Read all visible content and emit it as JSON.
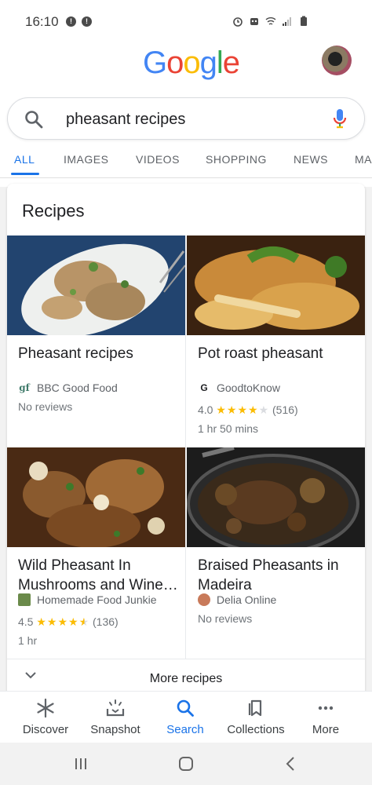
{
  "status": {
    "time": "16:10",
    "notifications": [
      "!",
      "!"
    ]
  },
  "header": {
    "logo_letters": [
      {
        "ch": "G",
        "color": "#4285f4"
      },
      {
        "ch": "o",
        "color": "#ea4335"
      },
      {
        "ch": "o",
        "color": "#fbbc05"
      },
      {
        "ch": "g",
        "color": "#4285f4"
      },
      {
        "ch": "l",
        "color": "#34a853"
      },
      {
        "ch": "e",
        "color": "#ea4335"
      }
    ]
  },
  "search": {
    "query": "pheasant recipes"
  },
  "tabs": [
    "ALL",
    "IMAGES",
    "VIDEOS",
    "SHOPPING",
    "NEWS",
    "MA"
  ],
  "recipes": {
    "title": "Recipes",
    "items": [
      {
        "name": "Pheasant recipes",
        "source": "BBC Good Food",
        "source_logo": "gf",
        "reviews": "No reviews",
        "rating": null,
        "count": null,
        "time": null
      },
      {
        "name": "Pot roast pheasant",
        "source": "GoodtoKnow",
        "source_logo": "G",
        "reviews": null,
        "rating": "4.0",
        "stars_filled": 4,
        "count": "(516)",
        "time": "1 hr 50 mins"
      },
      {
        "name": "Wild Pheasant In Mushrooms and Wine…",
        "source": "Homemade Food Junkie",
        "source_logo": "",
        "reviews": null,
        "rating": "4.5",
        "stars_filled": 4.5,
        "count": "(136)",
        "time": "1 hr"
      },
      {
        "name": "Braised Pheasants in Madeira",
        "source": "Delia Online",
        "source_logo": "",
        "reviews": "No reviews",
        "rating": null,
        "count": null,
        "time": null
      }
    ],
    "more_label": "More recipes"
  },
  "bottom_nav": [
    {
      "label": "Discover",
      "icon": "asterisk-icon",
      "active": false
    },
    {
      "label": "Snapshot",
      "icon": "snapshot-icon",
      "active": false
    },
    {
      "label": "Search",
      "icon": "search-icon",
      "active": true
    },
    {
      "label": "Collections",
      "icon": "collections-icon",
      "active": false
    },
    {
      "label": "More",
      "icon": "more-dots-icon",
      "active": false
    }
  ],
  "colors": {
    "accent": "#1a73e8",
    "star": "#fbbc04"
  }
}
